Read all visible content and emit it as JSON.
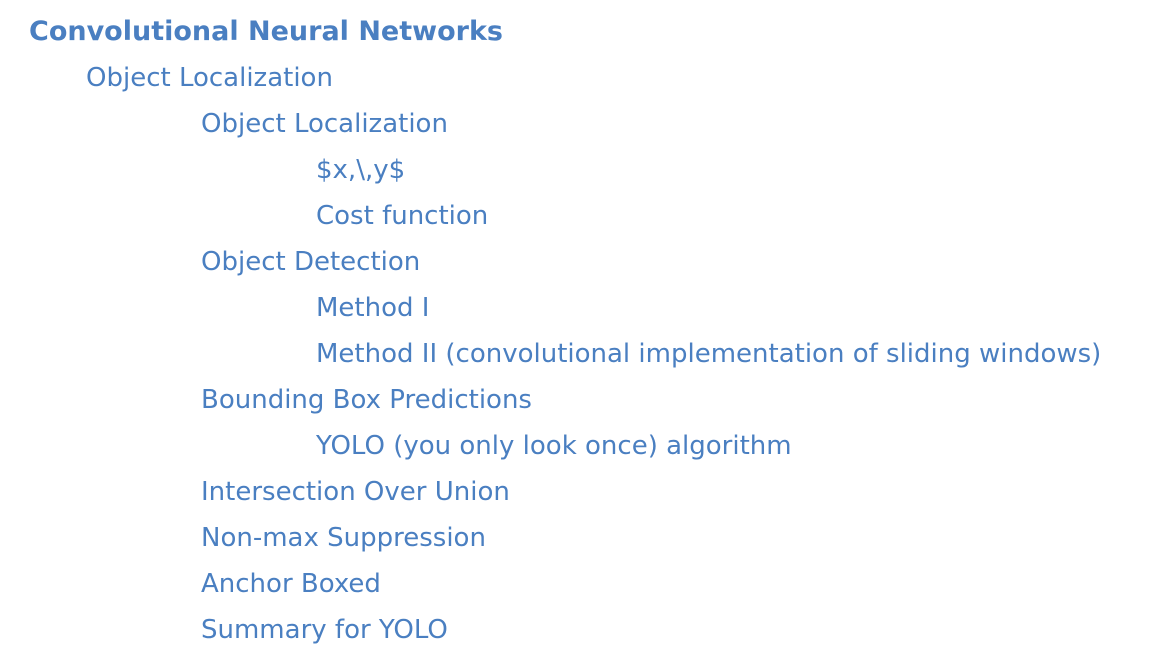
{
  "toc": {
    "title": "Convolutional Neural Networks",
    "section": "Object Localization",
    "items": [
      {
        "label": "Object Localization"
      },
      {
        "label": "$x,\\,y$"
      },
      {
        "label": "Cost function"
      },
      {
        "label": "Object Detection"
      },
      {
        "label": "Method I"
      },
      {
        "label": "Method II (convolutional implementation of sliding windows)"
      },
      {
        "label": "Bounding Box Predictions"
      },
      {
        "label": "YOLO (you only look once) algorithm"
      },
      {
        "label": "Intersection Over Union"
      },
      {
        "label": "Non-max Suppression"
      },
      {
        "label": "Anchor Boxed"
      },
      {
        "label": "Summary for YOLO"
      }
    ]
  },
  "colors": {
    "link": "#4a7fc1",
    "background": "#ffffff"
  }
}
